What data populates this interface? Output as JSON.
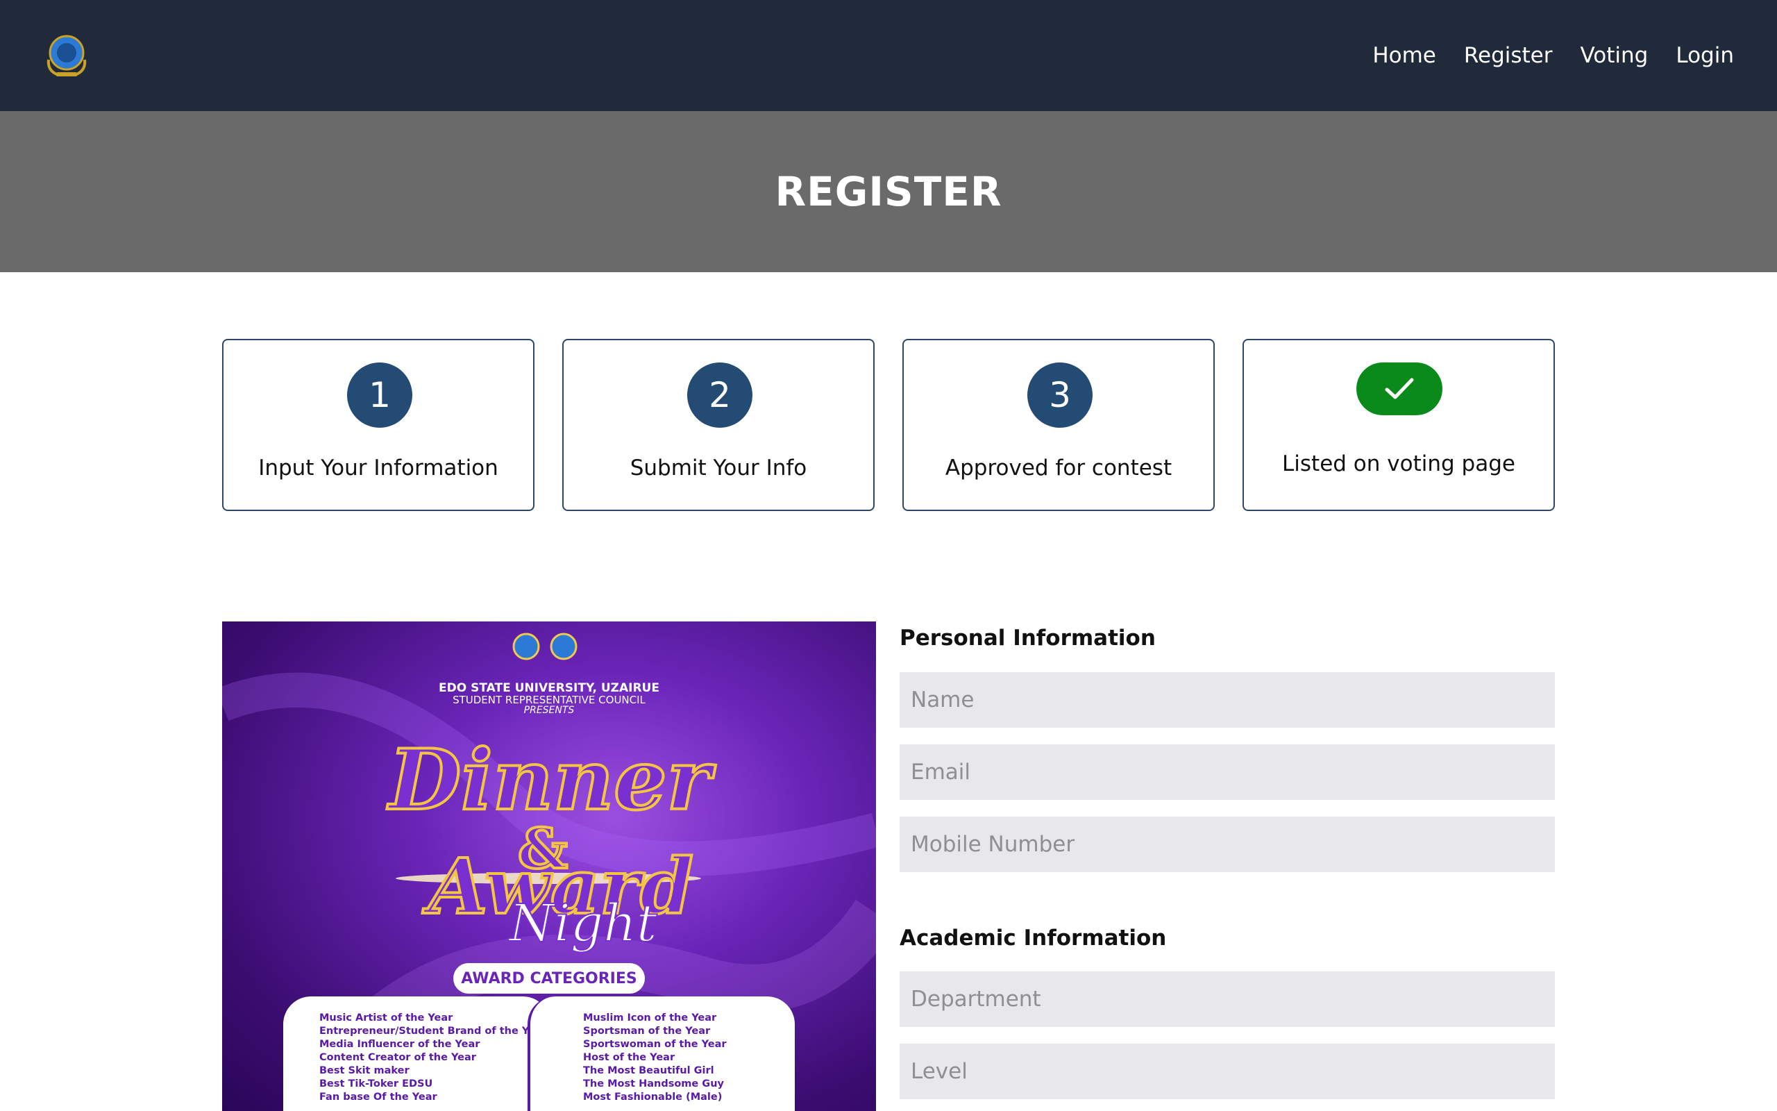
{
  "nav": {
    "logo_icon": "src-crest-logo-icon",
    "links": [
      "Home",
      "Register",
      "Voting",
      "Login"
    ]
  },
  "banner": {
    "title": "REGISTER"
  },
  "steps": [
    {
      "number": "1",
      "label": "Input Your Information"
    },
    {
      "number": "2",
      "label": "Submit Your Info"
    },
    {
      "number": "3",
      "label": "Approved for contest"
    },
    {
      "icon": "check-icon",
      "label": "Listed on voting page"
    }
  ],
  "poster": {
    "org_line1": "EDO STATE UNIVERSITY, UZAIRUE",
    "org_line2": "STUDENT REPRESENTATIVE COUNCIL",
    "org_line3": "PRESENTS",
    "title_line1": "Dinner",
    "title_amp": "&",
    "title_line2": "Award",
    "title_line3": "Night",
    "badge": "AWARD CATEGORIES",
    "categories_left": [
      "Music Artist of the Year",
      "Entrepreneur/Student Brand of the Year",
      "Media Influencer of the Year",
      "Content Creator of the Year",
      "Best Skit maker",
      "Best Tik-Toker EDSU",
      "Fan base Of the Year"
    ],
    "categories_right": [
      "Muslim Icon of the Year",
      "Sportsman of the Year",
      "Sportswoman of the Year",
      "Host of the Year",
      "The Most Beautiful Girl",
      "The Most Handsome Guy",
      "Most Fashionable (Male)"
    ]
  },
  "form": {
    "personal_title": "Personal Information",
    "name_placeholder": "Name",
    "email_placeholder": "Email",
    "mobile_placeholder": "Mobile Number",
    "academic_title": "Academic Information",
    "department_placeholder": "Department",
    "level_placeholder": "Level"
  },
  "colors": {
    "navbar": "#212a3a",
    "banner": "#6a6a6a",
    "step_circle": "#234b73",
    "check_badge": "#0a8a1a",
    "field_bg": "#e8e7ea"
  }
}
